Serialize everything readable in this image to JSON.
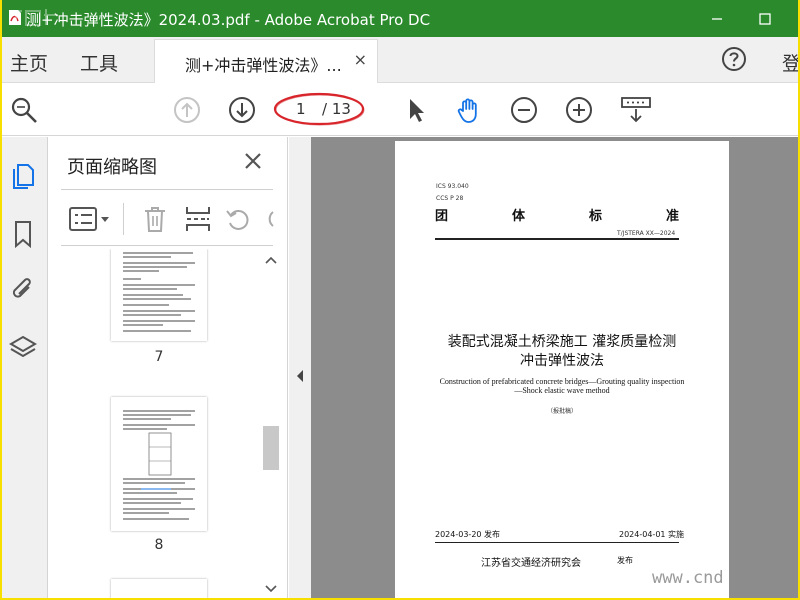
{
  "window": {
    "title": "测+冲击弹性波法》2024.03.pdf - Adobe Acrobat Pro DC",
    "watermark_overlay": "建标库"
  },
  "menu": {
    "home": "主页",
    "tools": "工具",
    "login": "登"
  },
  "tab": {
    "label": "测+冲击弹性波法》...",
    "close": "×"
  },
  "toolbar": {
    "current_page": "1",
    "total_pages": "/ 13"
  },
  "panel": {
    "title": "页面缩略图",
    "thumbnails": [
      {
        "label": "7"
      },
      {
        "label": "8"
      }
    ]
  },
  "page": {
    "ics": "ICS 93.040",
    "ccs": "CCS P 28",
    "head_chars": [
      "团",
      "体",
      "标",
      "准"
    ],
    "code": "T/JSTERA XX—2024",
    "title_line1": "装配式混凝土桥梁施工  灌浆质量检测",
    "title_line2": "冲击弹性波法",
    "en_line1": "Construction of prefabricated concrete bridges—Grouting quality inspection",
    "en_line2": "—Shock elastic wave method",
    "draft": "（报批稿）",
    "date_publish": "2024-03-20 发布",
    "date_implement": "2024-04-01 实施",
    "org": "江苏省交通经济研究会",
    "pub": "发布"
  },
  "watermark": "www.cnd",
  "colors": {
    "titlebar": "#2a8a2c",
    "frame": "#f7e000",
    "accent_blue": "#1473e6",
    "annotation_red": "#d8252b"
  }
}
